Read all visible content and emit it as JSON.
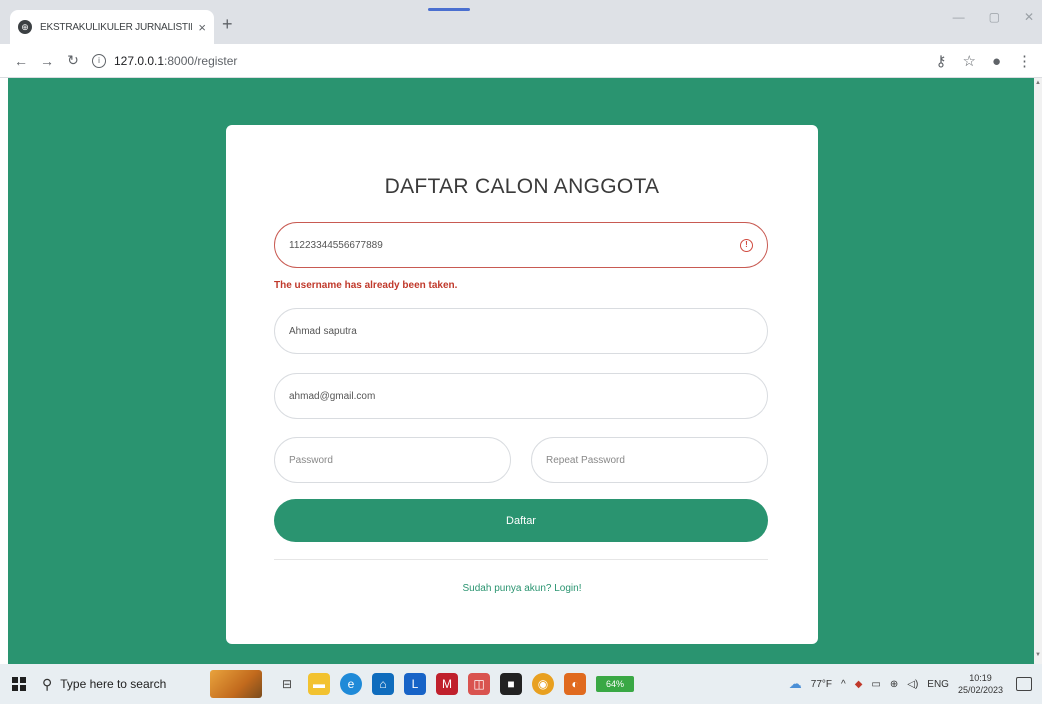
{
  "browser": {
    "tab_title": "EKSTRAKULIKULER JURNALISTIK",
    "new_tab": "+",
    "close_tab": "×",
    "url_host": "127.0.0.1",
    "url_path": ":8000/register"
  },
  "page": {
    "title": "DAFTAR CALON ANGGOTA",
    "username_value": "11223344556677889",
    "username_error": "The username has already been taken.",
    "fullname_value": "Ahmad saputra",
    "email_value": "ahmad@gmail.com",
    "password_placeholder": "Password",
    "repeat_password_placeholder": "Repeat Password",
    "submit_label": "Daftar",
    "login_link": "Sudah punya akun? Login!"
  },
  "taskbar": {
    "search_placeholder": "Type here to search",
    "battery": "64%",
    "temperature": "77°F",
    "language": "ENG",
    "time": "10:19",
    "date": "25/02/2023"
  },
  "colors": {
    "page_bg": "#2a9470",
    "error": "#c0392b",
    "card": "#ffffff"
  }
}
